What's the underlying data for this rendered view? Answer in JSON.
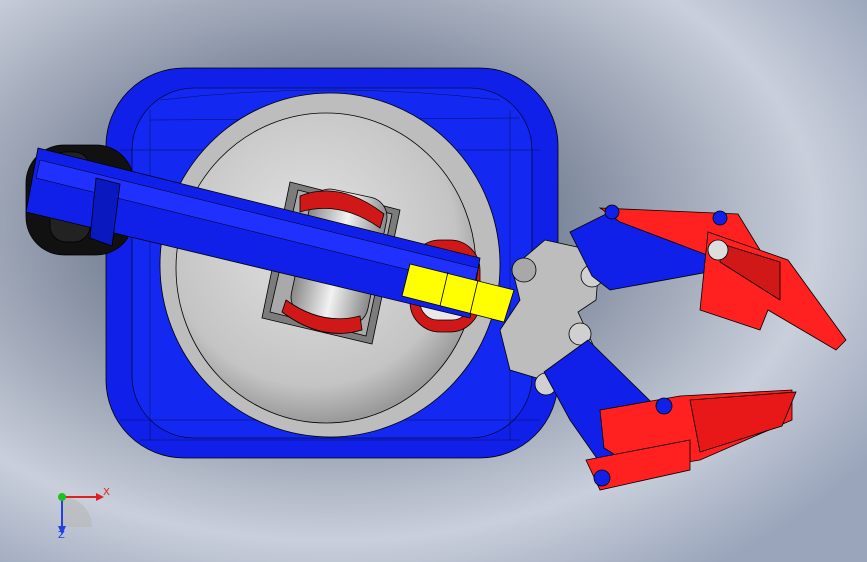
{
  "viewport": {
    "background_top": "#e6e9ef",
    "background_bottom": "#7f8aa6"
  },
  "model": {
    "colors": {
      "base_blue": "#1020e8",
      "turntable_grey": "#c8c8c8",
      "roller_red": "#d01818",
      "link_yellow": "#ffff00",
      "gripper_red": "#ff2020",
      "hub_grey": "#bdbdbd",
      "tire_black": "#111111",
      "edge_line": "#000000"
    }
  },
  "triad": {
    "x_label": "X",
    "z_label": "Z",
    "x_color": "#e02020",
    "y_color": "#20c020",
    "z_color": "#2040e0"
  }
}
